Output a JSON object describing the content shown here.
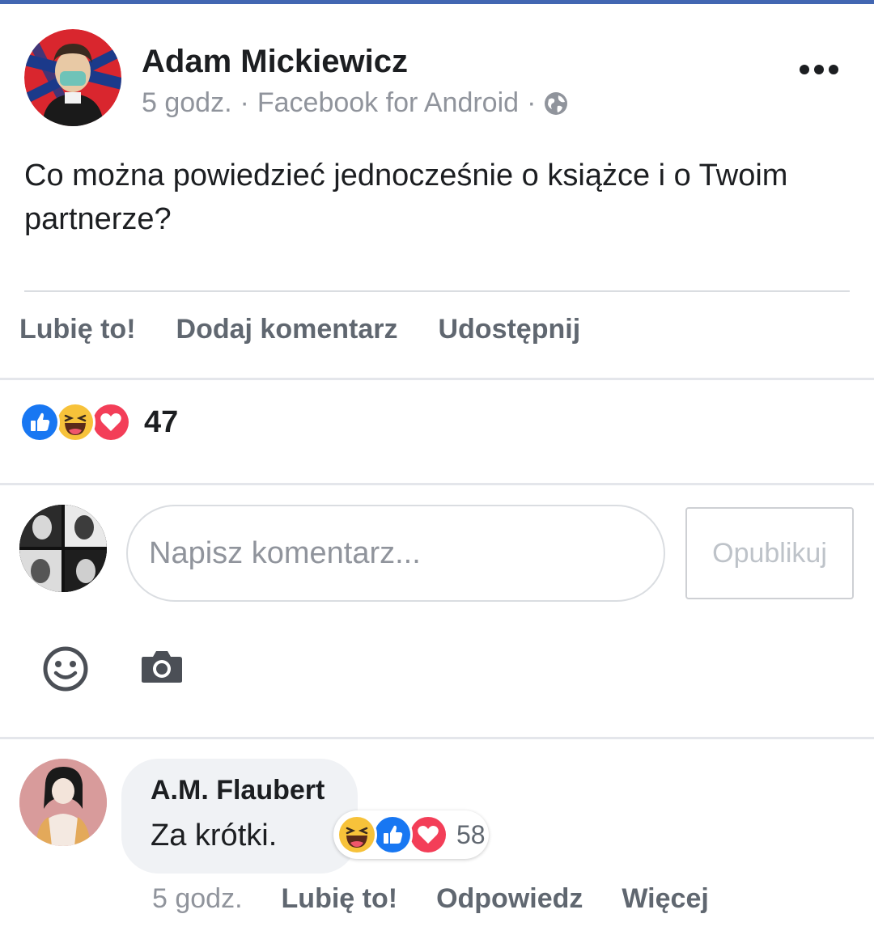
{
  "post": {
    "author": "Adam Mickiewicz",
    "time": "5 godz.",
    "source": "Facebook for Android",
    "separator": "·",
    "text": "Co można powiedzieć jednocześnie o książce i o Twoim partnerze?"
  },
  "actions": {
    "like": "Lubię to!",
    "comment": "Dodaj komentarz",
    "share": "Udostępnij"
  },
  "reactions": {
    "types": [
      "like",
      "haha",
      "love"
    ],
    "count": "47"
  },
  "composer": {
    "placeholder": "Napisz komentarz...",
    "publish": "Opublikuj"
  },
  "comment": {
    "author": "A.M. Flaubert",
    "text": "Za krótki.",
    "reaction_types": [
      "haha",
      "like",
      "love"
    ],
    "reaction_count": "58",
    "time": "5 godz.",
    "like": "Lubię to!",
    "reply": "Odpowiedz",
    "more": "Więcej"
  },
  "colors": {
    "brand": "#4267b2",
    "like_blue": "#1877f2",
    "love_red": "#f33e58",
    "haha_yellow": "#f7c23a"
  }
}
